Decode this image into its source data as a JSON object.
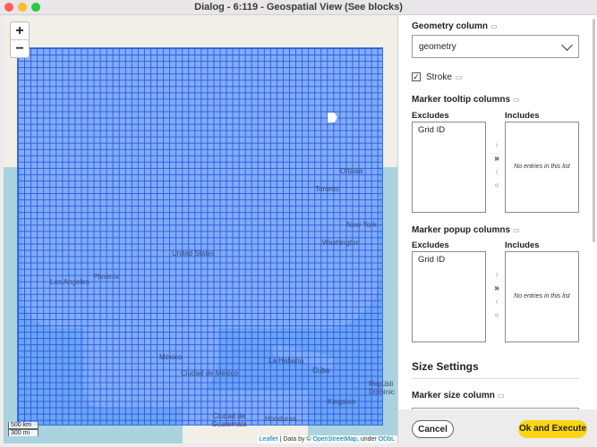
{
  "window": {
    "title": "Dialog - 6:119 - Geospatial View (See blocks)"
  },
  "map": {
    "zoom_in": "+",
    "zoom_out": "−",
    "scale_km": "500 km",
    "scale_mi": "300 mi",
    "attribution": {
      "leaflet": "Leaflet",
      "data_by": "Data by ©",
      "osm": "OpenStreetMap",
      "under": ", under",
      "odbl": "ODbL"
    },
    "places": [
      "Ottawa",
      "Toronto",
      "New York",
      "Washington",
      "United States",
      "Phoenix",
      "Los Angeles",
      "México",
      "Ciudad de México",
      "La Habana",
      "Cuba",
      "Honduras",
      "Ciudad de Guatemala",
      "Kingston",
      "Repúbli Dominic"
    ],
    "grid_color": "#5a93ff"
  },
  "panel": {
    "geometry_label": "Geometry column",
    "geometry_value": "geometry",
    "stroke_label": "Stroke",
    "stroke_checked": "✓",
    "tooltip_label": "Marker tooltip columns",
    "popup_label": "Marker popup columns",
    "excludes": "Excludes",
    "includes": "Includes",
    "excluded_item": "Grid ID",
    "empty_list": "No entries in this list",
    "size_settings": "Size Settings",
    "marker_size_label": "Marker size column",
    "arrows": [
      "›",
      "»",
      "‹",
      "«"
    ]
  },
  "footer": {
    "cancel": "Cancel",
    "ok": "Ok and Execute"
  }
}
